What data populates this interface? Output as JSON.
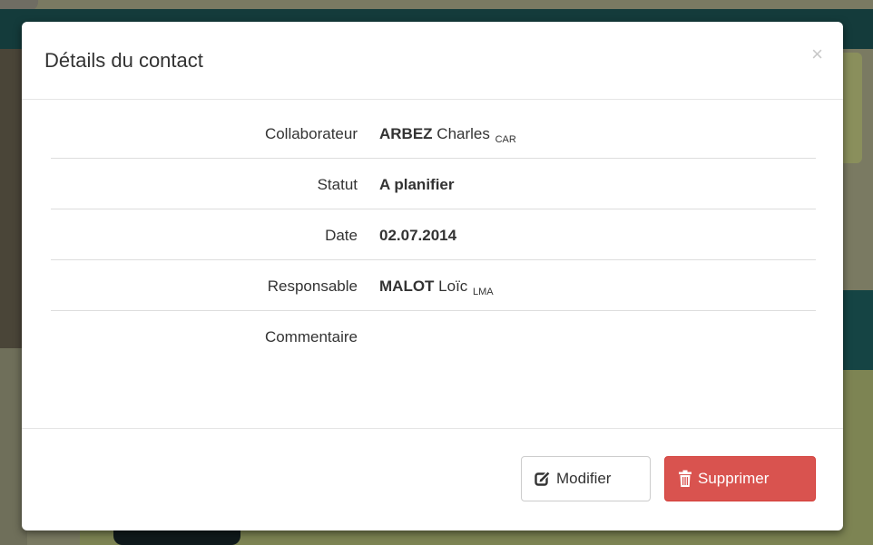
{
  "modal": {
    "title": "Détails du contact",
    "close_label": "×",
    "fields": [
      {
        "label": "Collaborateur",
        "value_bold": "ARBEZ",
        "value_rest": " Charles",
        "value_sub": "CAR"
      },
      {
        "label": "Statut",
        "value_bold": "A planifier",
        "value_rest": "",
        "value_sub": ""
      },
      {
        "label": "Date",
        "value_bold": "02.07.2014",
        "value_rest": "",
        "value_sub": ""
      },
      {
        "label": "Responsable",
        "value_bold": "MALOT",
        "value_rest": " Loïc",
        "value_sub": "LMA"
      },
      {
        "label": "Commentaire",
        "value_bold": "",
        "value_rest": "",
        "value_sub": ""
      }
    ],
    "buttons": {
      "edit_label": "Modifier",
      "delete_label": "Supprimer"
    },
    "icons": {
      "edit": "edit-icon",
      "delete": "trash-icon",
      "close": "close-icon"
    },
    "colors": {
      "danger": "#d9534f",
      "text": "#333333"
    }
  }
}
